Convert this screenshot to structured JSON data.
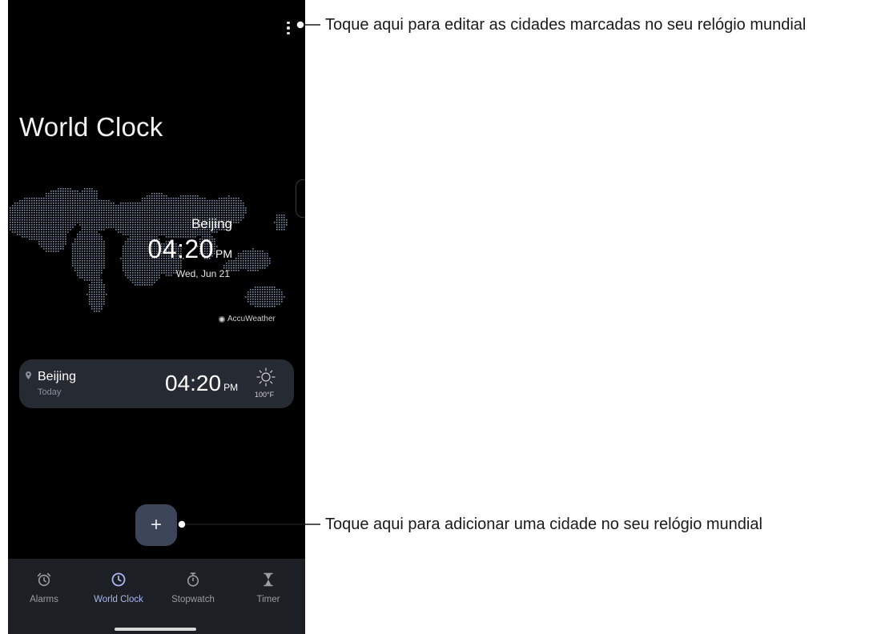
{
  "page": {
    "title": "World Clock"
  },
  "map": {
    "city": "Beijing",
    "time": "04:20",
    "ampm": "PM",
    "date": "Wed, Jun 21",
    "provider": "AccuWeather"
  },
  "card": {
    "city": "Beijing",
    "day": "Today",
    "time": "04:20",
    "ampm": "PM",
    "weather_icon": "sun-icon",
    "temperature": "100°F"
  },
  "fab": {
    "label": "+"
  },
  "nav": {
    "items": [
      {
        "label": "Alarms",
        "icon": "alarm-clock-icon",
        "active": false
      },
      {
        "label": "World Clock",
        "icon": "clock-icon",
        "active": true
      },
      {
        "label": "Stopwatch",
        "icon": "stopwatch-icon",
        "active": false
      },
      {
        "label": "Timer",
        "icon": "hourglass-icon",
        "active": false
      }
    ]
  },
  "annotations": {
    "menu": "Toque aqui para editar as cidades marcadas no seu relógio mundial",
    "add": "Toque aqui para adicionar uma cidade no seu relógio mundial"
  },
  "colors": {
    "screen_bg": "#000000",
    "card_bg": "#252a33",
    "fab_bg": "#3d4658",
    "nav_bg": "#1c1f24",
    "active_accent": "#aab7f0",
    "map_dots": "#7d8ea8"
  }
}
